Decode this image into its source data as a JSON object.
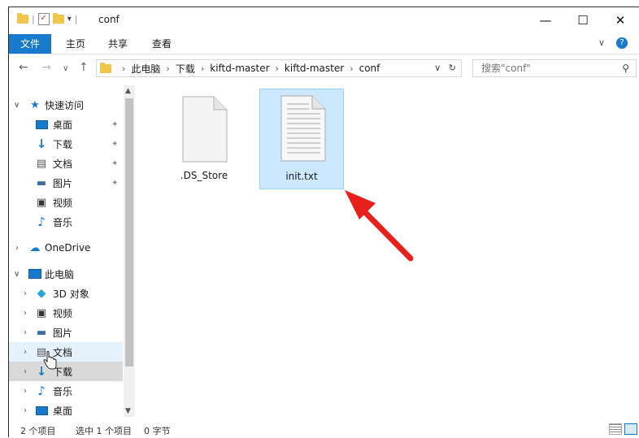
{
  "window": {
    "title": "conf",
    "minimize": "—",
    "maximize": "☐",
    "close": "✕"
  },
  "ribbon": {
    "tabs": [
      "文件",
      "主页",
      "共享",
      "查看"
    ]
  },
  "address": {
    "crumbs": [
      "此电脑",
      "下载",
      "kiftd-master",
      "kiftd-master",
      "conf"
    ],
    "refresh": "↻",
    "dropdown": "∨"
  },
  "search": {
    "placeholder": "搜索\"conf\""
  },
  "nav": {
    "quick_access": "快速访问",
    "quick_items": [
      "桌面",
      "下载",
      "文档",
      "图片",
      "视频",
      "音乐"
    ],
    "onedrive": "OneDrive",
    "this_pc": "此电脑",
    "pc_items": [
      "3D 对象",
      "视频",
      "图片",
      "文档",
      "下载",
      "音乐",
      "桌面"
    ]
  },
  "files": [
    {
      "name": ".DS_Store",
      "selected": false
    },
    {
      "name": "init.txt",
      "selected": true
    }
  ],
  "status": {
    "count": "2 个项目",
    "selection": "选中 1 个项目",
    "size": "0 字节"
  },
  "colors": {
    "accent": "#1979ca",
    "selection": "#cce8ff",
    "annotation": "#e8201c"
  }
}
